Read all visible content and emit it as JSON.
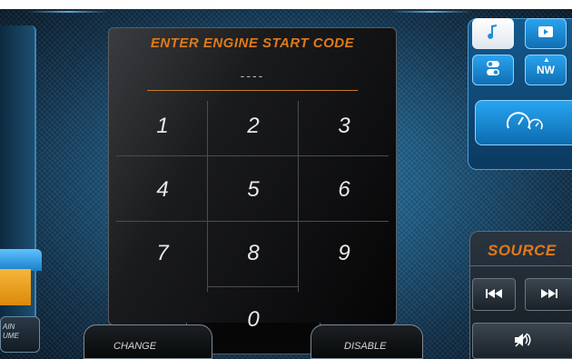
{
  "keypad": {
    "title": "ENTER ENGINE START CODE",
    "code_display": "----",
    "keys": [
      "1",
      "2",
      "3",
      "4",
      "5",
      "6",
      "7",
      "8",
      "9"
    ],
    "key_zero": "0"
  },
  "buttons": {
    "change": "CHANGE",
    "disable": "DISABLE"
  },
  "left_panel": {
    "volume_label_line1": "AIN",
    "volume_label_line2": "UME"
  },
  "right_panel": {
    "source_label": "SOURCE",
    "nav_label": "NW",
    "icons": [
      "music-note-icon",
      "video-play-icon",
      "toggle-settings-icon",
      "compass-north-icon",
      "gauges-icon",
      "previous-track-icon",
      "next-track-icon",
      "mute-icon"
    ]
  },
  "colors": {
    "accent_orange": "#e07a1a",
    "accent_blue": "#1f8fd8",
    "keypad_bg": "#0a0a0b"
  }
}
